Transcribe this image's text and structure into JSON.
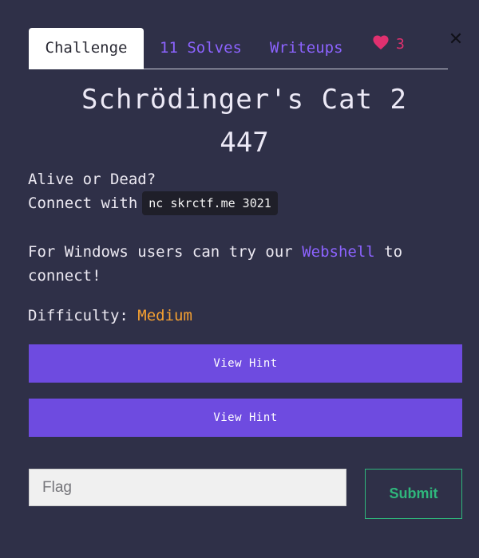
{
  "tabs": {
    "challenge": "Challenge",
    "solves": "11 Solves",
    "writeups": "Writeups"
  },
  "likes": {
    "icon": "heart-icon",
    "count": "3",
    "color": "#e0306f"
  },
  "close_icon": "close-icon",
  "challenge": {
    "name": "Schrödinger's Cat 2",
    "points": "447",
    "description": {
      "line1": "Alive or Dead?",
      "connect_prefix": "Connect with",
      "command": "nc skrctf.me 3021",
      "windows_text": "For Windows users can try our",
      "webshell_link": "Webshell",
      "windows_suffix": "to",
      "connect_end": "connect!"
    },
    "difficulty_label": "Difficulty:",
    "difficulty_value": "Medium"
  },
  "hints": [
    {
      "label": "View Hint"
    },
    {
      "label": "View Hint"
    }
  ],
  "flag": {
    "placeholder": "Flag",
    "value": ""
  },
  "submit_label": "Submit",
  "colors": {
    "background": "#2f3048",
    "accent": "#6e4be0",
    "link": "#8c63ff",
    "difficulty": "#f5a031",
    "submit": "#2fb77c"
  }
}
